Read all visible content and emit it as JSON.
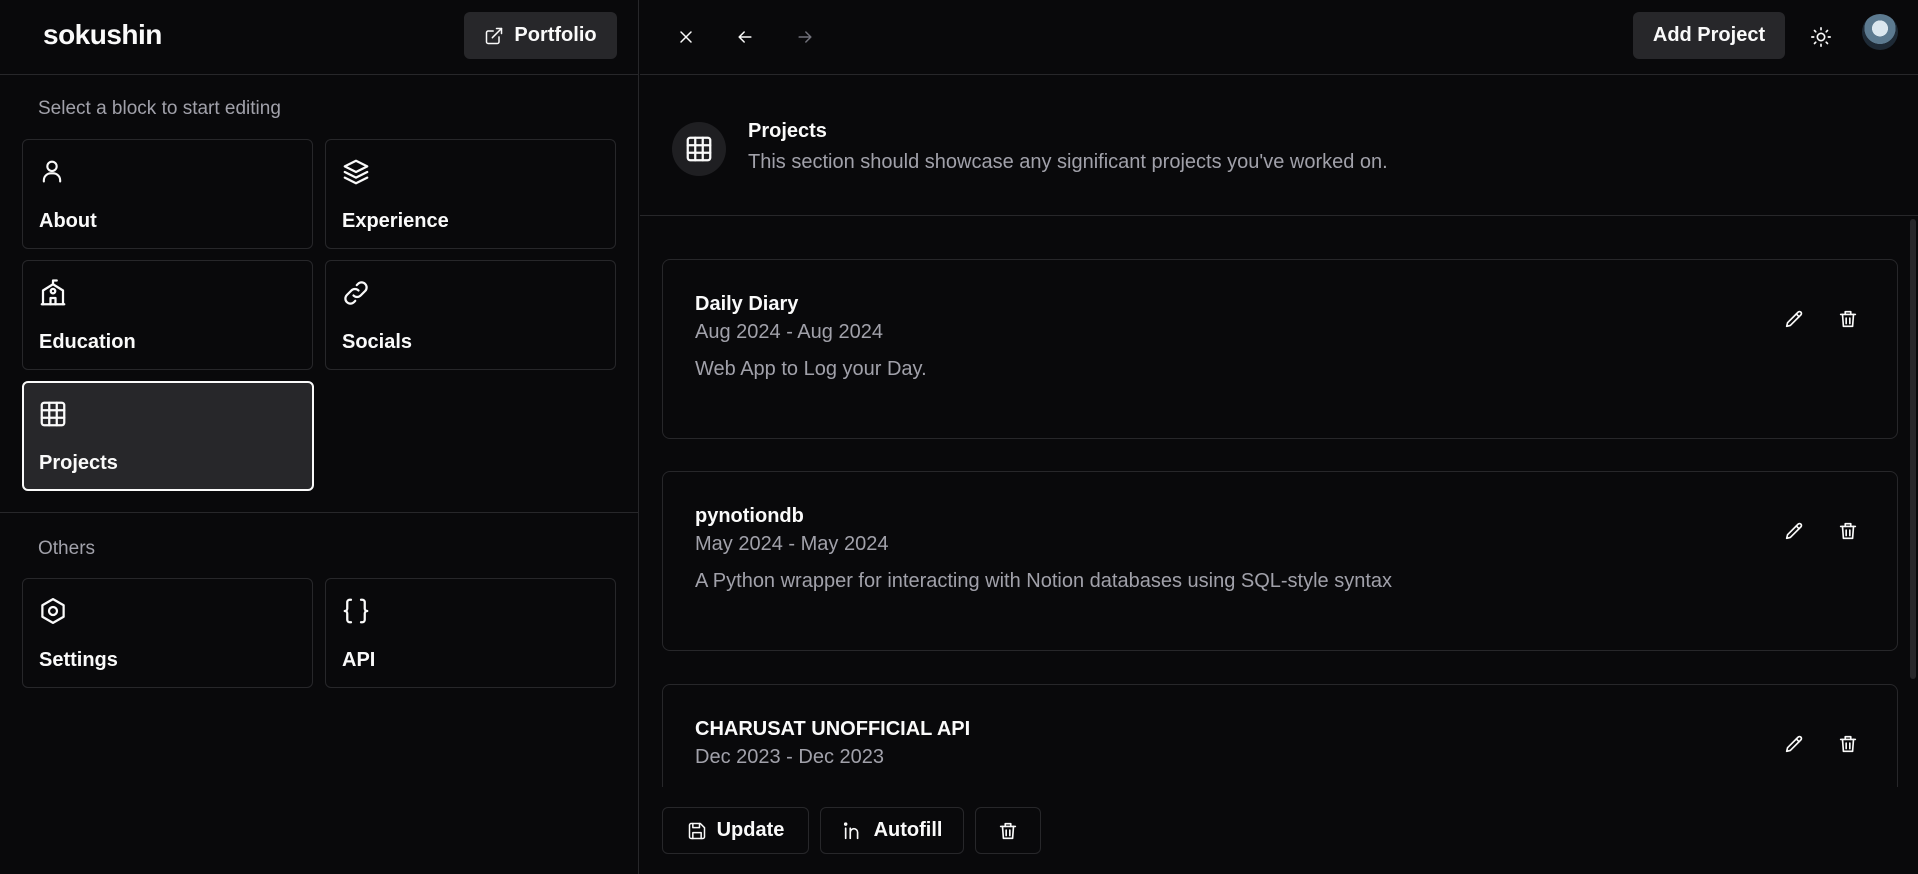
{
  "brand": "sokushin",
  "header": {
    "portfolio_label": "Portfolio",
    "add_project_label": "Add Project"
  },
  "sidebar": {
    "section_label": "Select a block to start editing",
    "blocks": [
      {
        "label": "About",
        "icon": "user-icon"
      },
      {
        "label": "Experience",
        "icon": "layers-icon"
      },
      {
        "label": "Education",
        "icon": "school-icon"
      },
      {
        "label": "Socials",
        "icon": "link-icon"
      },
      {
        "label": "Projects",
        "icon": "grid-icon",
        "active": true
      }
    ],
    "others_label": "Others",
    "others": [
      {
        "label": "Settings",
        "icon": "hexagon-icon"
      },
      {
        "label": "API",
        "icon": "braces-icon"
      }
    ]
  },
  "section": {
    "title": "Projects",
    "description": "This section should showcase any significant projects you've worked on."
  },
  "projects": [
    {
      "name": "Daily Diary",
      "dates": "Aug 2024 - Aug 2024",
      "description": "Web App to Log your Day."
    },
    {
      "name": "pynotiondb",
      "dates": "May 2024 - May 2024",
      "description": "A Python wrapper for interacting with Notion databases using SQL-style syntax"
    },
    {
      "name": "CHARUSAT UNOFFICIAL API",
      "dates": "Dec 2023 - Dec 2023",
      "description": ""
    }
  ],
  "footer": {
    "update_label": "Update",
    "autofill_label": "Autofill"
  },
  "colors": {
    "background": "#09090b",
    "surface": "#27272a",
    "border": "#27272a",
    "text": "#fafafa",
    "muted_text": "#a1a1aa"
  }
}
